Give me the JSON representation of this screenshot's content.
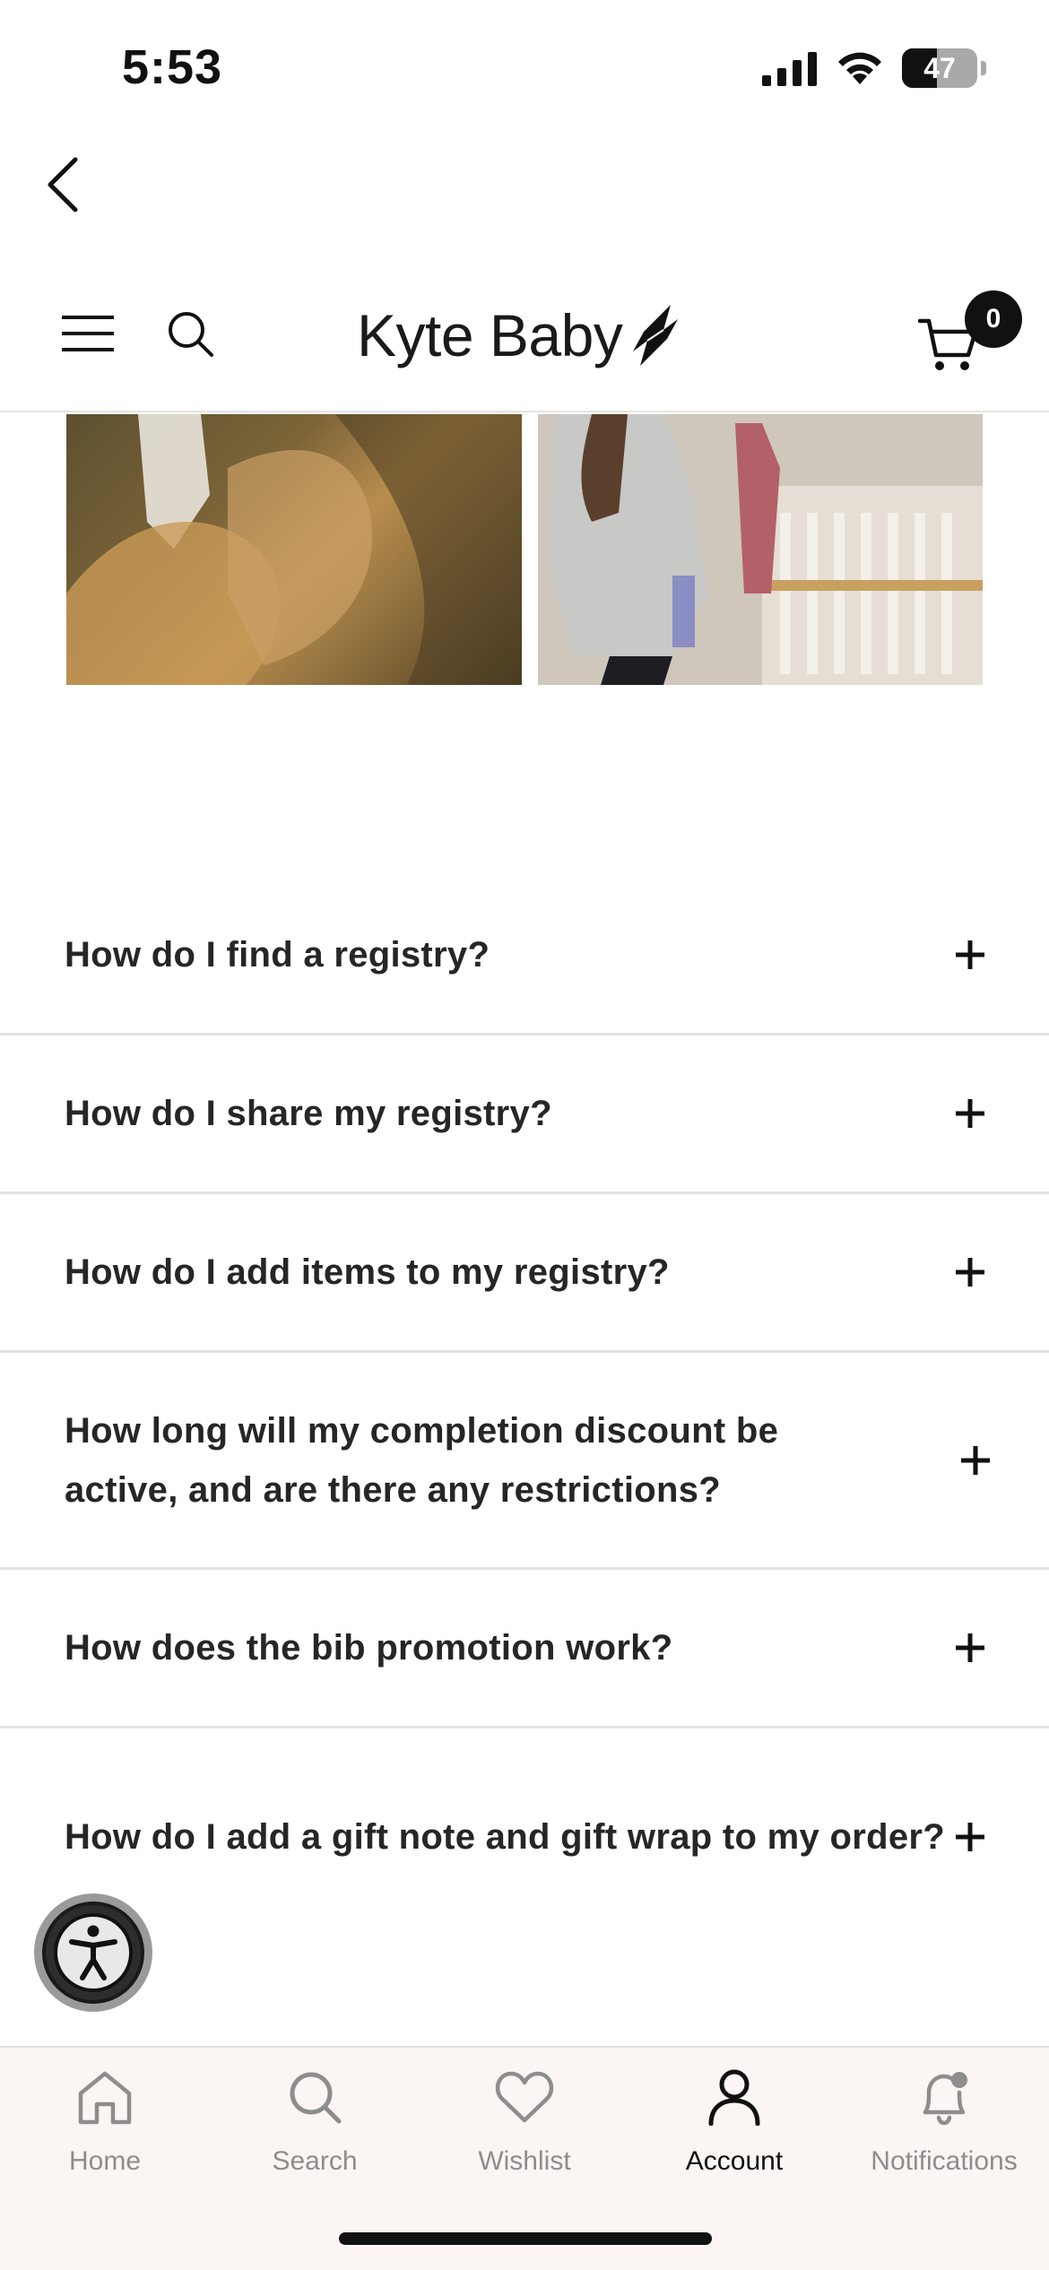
{
  "status_bar": {
    "time": "5:53",
    "battery": "47"
  },
  "header": {
    "logo_text": "Kyte Baby",
    "cart_count": "0"
  },
  "faq": [
    {
      "question": "How do I find a registry?"
    },
    {
      "question": "How do I share my registry?"
    },
    {
      "question": "How do I add items to my registry?"
    },
    {
      "question": "How long will my completion discount be active, and are there any restrictions?"
    },
    {
      "question": "How does the bib promotion work?"
    },
    {
      "question": "How do I add a gift note and gift wrap to my order?"
    }
  ],
  "tab_bar": {
    "tabs": [
      {
        "label": "Home",
        "icon": "home-icon"
      },
      {
        "label": "Search",
        "icon": "search-icon"
      },
      {
        "label": "Wishlist",
        "icon": "heart-icon"
      },
      {
        "label": "Account",
        "icon": "user-icon",
        "active": true
      },
      {
        "label": "Notifications",
        "icon": "bell-icon"
      }
    ]
  },
  "colors": {
    "tab_bar_bg": "#fbf5f3",
    "text": "#262626",
    "inactive_tab": "#8d8d8d"
  }
}
